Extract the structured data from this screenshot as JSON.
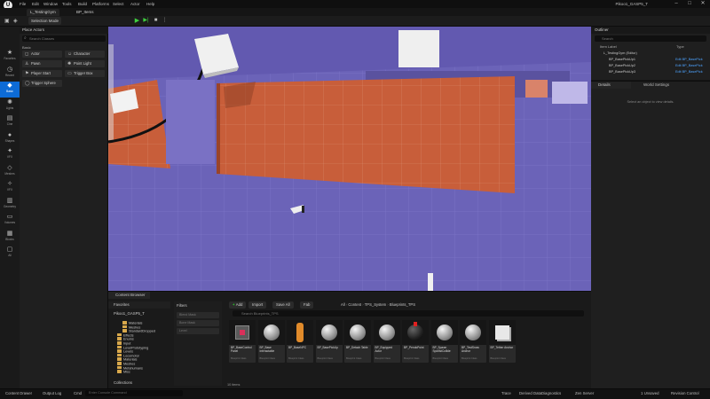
{
  "window": {
    "title": "Pikoo1_GASP5_T",
    "menus": [
      "File",
      "Edit",
      "Window",
      "Tools",
      "Build",
      "Platforms",
      "Select",
      "Actor",
      "Help"
    ],
    "tabs": [
      "L_TestingGym",
      "BP_Items"
    ]
  },
  "toolbar": {
    "selection_mode": "Selection Mode"
  },
  "sidebar": {
    "items": [
      {
        "label": "Favorites",
        "icon": "star-icon"
      },
      {
        "label": "Recent",
        "icon": "clock-icon"
      },
      {
        "label": "Basic",
        "icon": "cube-icon"
      },
      {
        "label": "Lights",
        "icon": "bulb-icon"
      },
      {
        "label": "Cine",
        "icon": "camera-icon"
      },
      {
        "label": "Shapes",
        "icon": "shapes-icon"
      },
      {
        "label": "VFX",
        "icon": "sparkle-icon"
      },
      {
        "label": "Meshes",
        "icon": "mesh-icon"
      },
      {
        "label": "VFX",
        "icon": "fx-icon"
      },
      {
        "label": "Geometry",
        "icon": "geometry-icon"
      },
      {
        "label": "Volumes",
        "icon": "volume-icon"
      },
      {
        "label": "Blocks",
        "icon": "blocks-icon"
      },
      {
        "label": "All",
        "icon": "all-icon"
      }
    ]
  },
  "place_actors": {
    "title": "Place Actors",
    "search_placeholder": "Search Classes",
    "section": "Basic",
    "actors": [
      "Actor",
      "Character",
      "Pawn",
      "Point Light",
      "Player Start",
      "Trigger Box",
      "Trigger Sphere"
    ]
  },
  "outliner": {
    "title": "Outliner",
    "search_placeholder": "Search",
    "col_label": "Item Label",
    "col_type": "Type",
    "rows": [
      {
        "name": "L_TestingGym (Editor)",
        "type": ""
      },
      {
        "name": "BP_BasePickUp1",
        "type": "Edit BP_BasePick"
      },
      {
        "name": "BP_BasePickUp2",
        "type": "Edit BP_BasePick"
      },
      {
        "name": "BP_BasePickUp3",
        "type": "Edit BP_BasePick"
      }
    ],
    "actor_count": "263 actors"
  },
  "details": {
    "tab_details": "Details",
    "tab_world": "World Settings",
    "empty_text": "Select an object to view details."
  },
  "content_browser": {
    "tab": "Content Browser",
    "favorites": "Favorites",
    "project": "Pikoo1_GASP5_T",
    "tree": [
      "Materials",
      "Meshes",
      "StandardDropped",
      "Effects",
      "Enums",
      "Input",
      "LevelPrototyping",
      "Levels",
      "Locomotor",
      "Materials",
      "Meshes",
      "Metahumans",
      "Misc"
    ],
    "collections": "Collections",
    "filters": {
      "title": "Filters",
      "chips": [
        "Blend Mask",
        "Bone Mask",
        "Level"
      ]
    },
    "buttons": {
      "add": "Add",
      "import": "Import",
      "save_all": "Save All",
      "fab": "Fab"
    },
    "breadcrumb": [
      "All",
      "Content",
      "TPS_System",
      "Blueprints_TPS"
    ],
    "search_placeholder": "Search Blueprints_TPS",
    "assets": [
      {
        "name": "BP_BaseControl Panel",
        "kind": "Blueprint Class",
        "thumb": "panel"
      },
      {
        "name": "BP_Base Interactable",
        "kind": "Blueprint Class",
        "thumb": "sphere"
      },
      {
        "name": "BP_BaseNPC",
        "kind": "Blueprint Class",
        "thumb": "npc"
      },
      {
        "name": "BP_BasePickUp",
        "kind": "Blueprint Class",
        "thumb": "sphere"
      },
      {
        "name": "BP_Detach Table",
        "kind": "Blueprint Class",
        "thumb": "sphere"
      },
      {
        "name": "BP_Equipped Actor",
        "kind": "Blueprint Class",
        "thumb": "sphere"
      },
      {
        "name": "BP_PendoPoint",
        "kind": "Blueprint Class",
        "thumb": "bomb"
      },
      {
        "name": "BP_Spawn SpotlistCollide",
        "kind": "Blueprint Class",
        "thumb": "sphere"
      },
      {
        "name": "BP_TestSnow Anchor",
        "kind": "Blueprint Class",
        "thumb": "sphere"
      },
      {
        "name": "BP_Tether Anchor",
        "kind": "Blueprint Class",
        "thumb": "cube"
      }
    ],
    "item_count": "10 items"
  },
  "statusbar": {
    "content_drawer": "Content Drawer",
    "output_log": "Output Log",
    "cmd": "Cmd",
    "cmd_placeholder": "Enter Console Command",
    "trace": "Trace",
    "derived_data": "Derived Data",
    "diagnostics": "Diagnostics",
    "zen_server": "Zen Server",
    "unsaved": "1 Unsaved",
    "revision_control": "Revision Control"
  },
  "colors": {
    "accent": "#0d6bd6",
    "floor": "#6b63b8",
    "wall": "#c85e3a",
    "play": "#3fd13f"
  }
}
